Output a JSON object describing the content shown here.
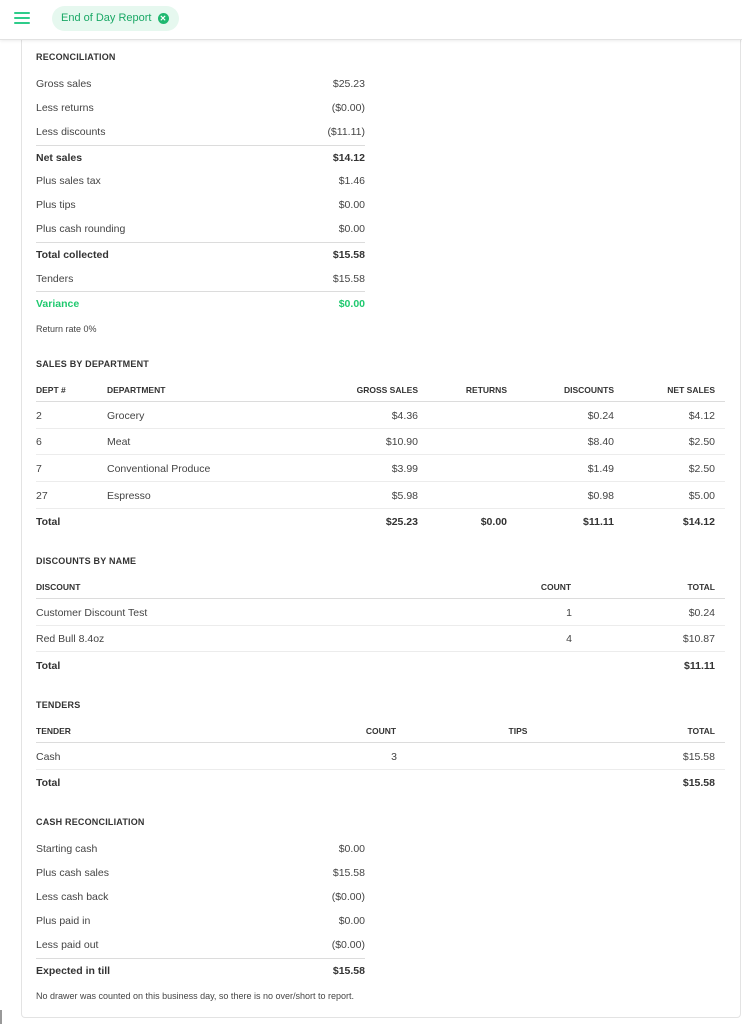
{
  "header": {
    "report_tab_label": "End of Day Report",
    "menu_icon": "hamburger-menu-icon",
    "close_icon": "close-circle-icon",
    "accent_color": "#20c96f"
  },
  "reconciliation": {
    "title": "RECONCILIATION",
    "rows": [
      {
        "label": "Gross sales",
        "value": "$25.23"
      },
      {
        "label": "Less returns",
        "value": "($0.00)"
      },
      {
        "label": "Less discounts",
        "value": "($11.11)"
      },
      {
        "label": "Net sales",
        "value": "$14.12"
      },
      {
        "label": "Plus sales tax",
        "value": "$1.46"
      },
      {
        "label": "Plus tips",
        "value": "$0.00"
      },
      {
        "label": "Plus cash rounding",
        "value": "$0.00"
      },
      {
        "label": "Total collected",
        "value": "$15.58"
      },
      {
        "label": "Tenders",
        "value": "$15.58"
      },
      {
        "label": "Variance",
        "value": "$0.00"
      }
    ],
    "return_rate": "Return rate 0%"
  },
  "sales_by_department": {
    "title": "SALES BY DEPARTMENT",
    "headers": [
      "DEPT #",
      "DEPARTMENT",
      "GROSS SALES",
      "RETURNS",
      "DISCOUNTS",
      "NET SALES"
    ],
    "rows": [
      {
        "dept": "2",
        "name": "Grocery",
        "gross": "$4.36",
        "returns": "",
        "discounts": "$0.24",
        "net": "$4.12"
      },
      {
        "dept": "6",
        "name": "Meat",
        "gross": "$10.90",
        "returns": "",
        "discounts": "$8.40",
        "net": "$2.50"
      },
      {
        "dept": "7",
        "name": "Conventional Produce",
        "gross": "$3.99",
        "returns": "",
        "discounts": "$1.49",
        "net": "$2.50"
      },
      {
        "dept": "27",
        "name": "Espresso",
        "gross": "$5.98",
        "returns": "",
        "discounts": "$0.98",
        "net": "$5.00"
      }
    ],
    "total": {
      "label": "Total",
      "gross": "$25.23",
      "returns": "$0.00",
      "discounts": "$11.11",
      "net": "$14.12"
    }
  },
  "discounts_by_name": {
    "title": "DISCOUNTS BY NAME",
    "headers": [
      "DISCOUNT",
      "COUNT",
      "TOTAL"
    ],
    "rows": [
      {
        "name": "Customer Discount Test",
        "count": "1",
        "total": "$0.24"
      },
      {
        "name": "Red Bull 8.4oz",
        "count": "4",
        "total": "$10.87"
      }
    ],
    "total": {
      "label": "Total",
      "total": "$11.11"
    }
  },
  "tenders": {
    "title": "TENDERS",
    "headers": [
      "TENDER",
      "COUNT",
      "TIPS",
      "TOTAL"
    ],
    "rows": [
      {
        "name": "Cash",
        "count": "3",
        "tips": "",
        "total": "$15.58"
      }
    ],
    "total": {
      "label": "Total",
      "total": "$15.58"
    }
  },
  "cash_reconciliation": {
    "title": "CASH RECONCILIATION",
    "rows": [
      {
        "label": "Starting cash",
        "value": "$0.00"
      },
      {
        "label": "Plus cash sales",
        "value": "$15.58"
      },
      {
        "label": "Less cash back",
        "value": "($0.00)"
      },
      {
        "label": "Plus paid in",
        "value": "$0.00"
      },
      {
        "label": "Less paid out",
        "value": "($0.00)"
      },
      {
        "label": "Expected in till",
        "value": "$15.58"
      }
    ],
    "note": "No drawer was counted on this business day, so there is no over/short to report."
  }
}
